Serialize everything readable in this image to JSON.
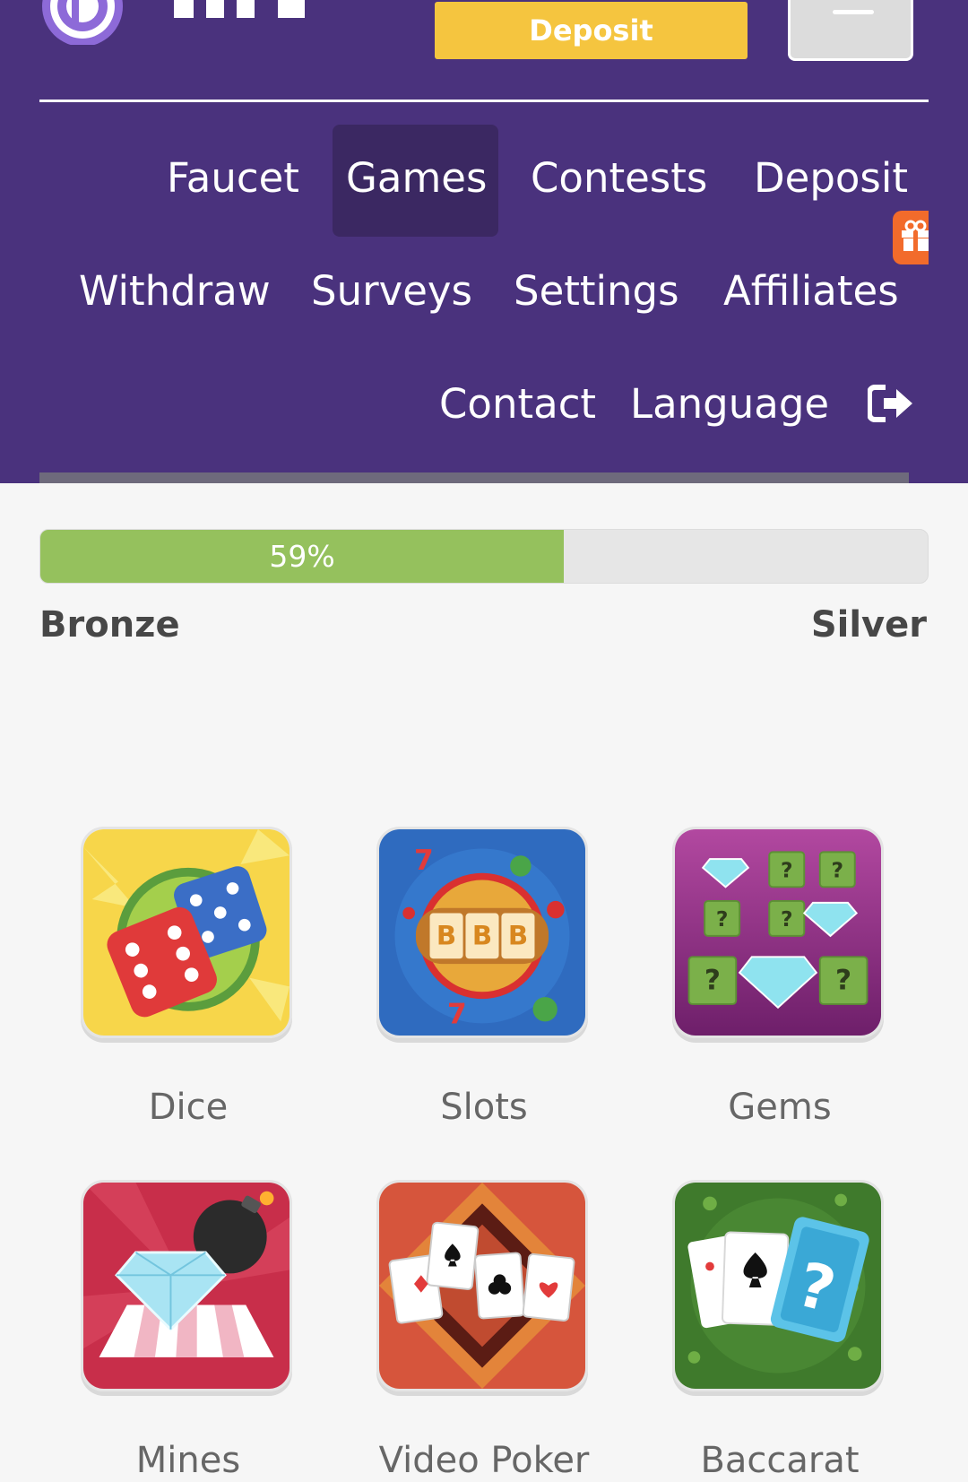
{
  "header": {
    "deposit_button": "Deposit",
    "nav": {
      "faucet": "Faucet",
      "games": "Games",
      "contests": "Contests",
      "deposit": "Deposit",
      "withdraw": "Withdraw",
      "surveys": "Surveys",
      "settings": "Settings",
      "affiliates": "Affiliates",
      "contact": "Contact",
      "language": "Language"
    },
    "active_tab": "Games",
    "icons": [
      "logo-icon",
      "menu-icon",
      "gift-icon",
      "logout-icon"
    ]
  },
  "progress": {
    "percent_label": "59%",
    "value": 0.59,
    "from_tier": "Bronze",
    "to_tier": "Silver"
  },
  "games": [
    {
      "label": "Dice",
      "icon": "dice-icon"
    },
    {
      "label": "Slots",
      "icon": "slots-icon"
    },
    {
      "label": "Gems",
      "icon": "gems-icon"
    },
    {
      "label": "Mines",
      "icon": "mines-icon"
    },
    {
      "label": "Video Poker",
      "icon": "video-poker-icon"
    },
    {
      "label": "Baccarat",
      "icon": "baccarat-icon"
    }
  ],
  "colors": {
    "header_bg": "#4a327d",
    "active_tab_bg": "#3b2862",
    "deposit_button": "#f5c53f",
    "progress_fill": "#95c15d",
    "gift_badge": "#f26b2b"
  }
}
